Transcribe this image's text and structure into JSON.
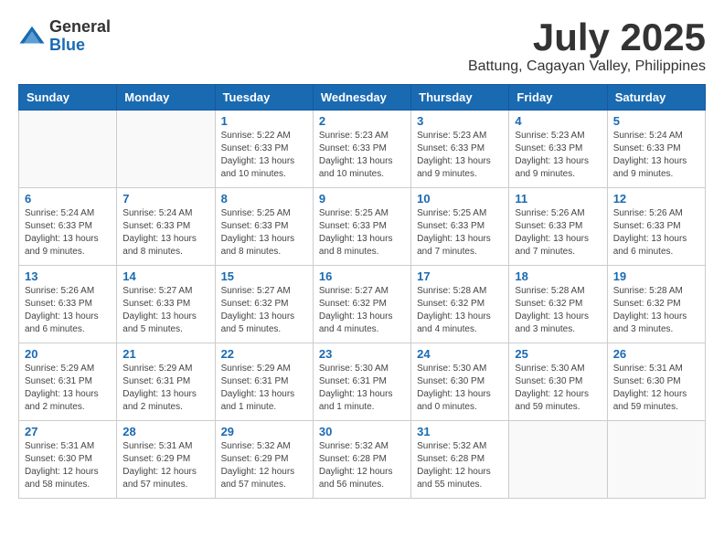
{
  "logo": {
    "general": "General",
    "blue": "Blue"
  },
  "title": "July 2025",
  "location": "Battung, Cagayan Valley, Philippines",
  "weekdays": [
    "Sunday",
    "Monday",
    "Tuesday",
    "Wednesday",
    "Thursday",
    "Friday",
    "Saturday"
  ],
  "weeks": [
    [
      {
        "day": "",
        "detail": ""
      },
      {
        "day": "",
        "detail": ""
      },
      {
        "day": "1",
        "detail": "Sunrise: 5:22 AM\nSunset: 6:33 PM\nDaylight: 13 hours\nand 10 minutes."
      },
      {
        "day": "2",
        "detail": "Sunrise: 5:23 AM\nSunset: 6:33 PM\nDaylight: 13 hours\nand 10 minutes."
      },
      {
        "day": "3",
        "detail": "Sunrise: 5:23 AM\nSunset: 6:33 PM\nDaylight: 13 hours\nand 9 minutes."
      },
      {
        "day": "4",
        "detail": "Sunrise: 5:23 AM\nSunset: 6:33 PM\nDaylight: 13 hours\nand 9 minutes."
      },
      {
        "day": "5",
        "detail": "Sunrise: 5:24 AM\nSunset: 6:33 PM\nDaylight: 13 hours\nand 9 minutes."
      }
    ],
    [
      {
        "day": "6",
        "detail": "Sunrise: 5:24 AM\nSunset: 6:33 PM\nDaylight: 13 hours\nand 9 minutes."
      },
      {
        "day": "7",
        "detail": "Sunrise: 5:24 AM\nSunset: 6:33 PM\nDaylight: 13 hours\nand 8 minutes."
      },
      {
        "day": "8",
        "detail": "Sunrise: 5:25 AM\nSunset: 6:33 PM\nDaylight: 13 hours\nand 8 minutes."
      },
      {
        "day": "9",
        "detail": "Sunrise: 5:25 AM\nSunset: 6:33 PM\nDaylight: 13 hours\nand 8 minutes."
      },
      {
        "day": "10",
        "detail": "Sunrise: 5:25 AM\nSunset: 6:33 PM\nDaylight: 13 hours\nand 7 minutes."
      },
      {
        "day": "11",
        "detail": "Sunrise: 5:26 AM\nSunset: 6:33 PM\nDaylight: 13 hours\nand 7 minutes."
      },
      {
        "day": "12",
        "detail": "Sunrise: 5:26 AM\nSunset: 6:33 PM\nDaylight: 13 hours\nand 6 minutes."
      }
    ],
    [
      {
        "day": "13",
        "detail": "Sunrise: 5:26 AM\nSunset: 6:33 PM\nDaylight: 13 hours\nand 6 minutes."
      },
      {
        "day": "14",
        "detail": "Sunrise: 5:27 AM\nSunset: 6:33 PM\nDaylight: 13 hours\nand 5 minutes."
      },
      {
        "day": "15",
        "detail": "Sunrise: 5:27 AM\nSunset: 6:32 PM\nDaylight: 13 hours\nand 5 minutes."
      },
      {
        "day": "16",
        "detail": "Sunrise: 5:27 AM\nSunset: 6:32 PM\nDaylight: 13 hours\nand 4 minutes."
      },
      {
        "day": "17",
        "detail": "Sunrise: 5:28 AM\nSunset: 6:32 PM\nDaylight: 13 hours\nand 4 minutes."
      },
      {
        "day": "18",
        "detail": "Sunrise: 5:28 AM\nSunset: 6:32 PM\nDaylight: 13 hours\nand 3 minutes."
      },
      {
        "day": "19",
        "detail": "Sunrise: 5:28 AM\nSunset: 6:32 PM\nDaylight: 13 hours\nand 3 minutes."
      }
    ],
    [
      {
        "day": "20",
        "detail": "Sunrise: 5:29 AM\nSunset: 6:31 PM\nDaylight: 13 hours\nand 2 minutes."
      },
      {
        "day": "21",
        "detail": "Sunrise: 5:29 AM\nSunset: 6:31 PM\nDaylight: 13 hours\nand 2 minutes."
      },
      {
        "day": "22",
        "detail": "Sunrise: 5:29 AM\nSunset: 6:31 PM\nDaylight: 13 hours\nand 1 minute."
      },
      {
        "day": "23",
        "detail": "Sunrise: 5:30 AM\nSunset: 6:31 PM\nDaylight: 13 hours\nand 1 minute."
      },
      {
        "day": "24",
        "detail": "Sunrise: 5:30 AM\nSunset: 6:30 PM\nDaylight: 13 hours\nand 0 minutes."
      },
      {
        "day": "25",
        "detail": "Sunrise: 5:30 AM\nSunset: 6:30 PM\nDaylight: 12 hours\nand 59 minutes."
      },
      {
        "day": "26",
        "detail": "Sunrise: 5:31 AM\nSunset: 6:30 PM\nDaylight: 12 hours\nand 59 minutes."
      }
    ],
    [
      {
        "day": "27",
        "detail": "Sunrise: 5:31 AM\nSunset: 6:30 PM\nDaylight: 12 hours\nand 58 minutes."
      },
      {
        "day": "28",
        "detail": "Sunrise: 5:31 AM\nSunset: 6:29 PM\nDaylight: 12 hours\nand 57 minutes."
      },
      {
        "day": "29",
        "detail": "Sunrise: 5:32 AM\nSunset: 6:29 PM\nDaylight: 12 hours\nand 57 minutes."
      },
      {
        "day": "30",
        "detail": "Sunrise: 5:32 AM\nSunset: 6:28 PM\nDaylight: 12 hours\nand 56 minutes."
      },
      {
        "day": "31",
        "detail": "Sunrise: 5:32 AM\nSunset: 6:28 PM\nDaylight: 12 hours\nand 55 minutes."
      },
      {
        "day": "",
        "detail": ""
      },
      {
        "day": "",
        "detail": ""
      }
    ]
  ]
}
